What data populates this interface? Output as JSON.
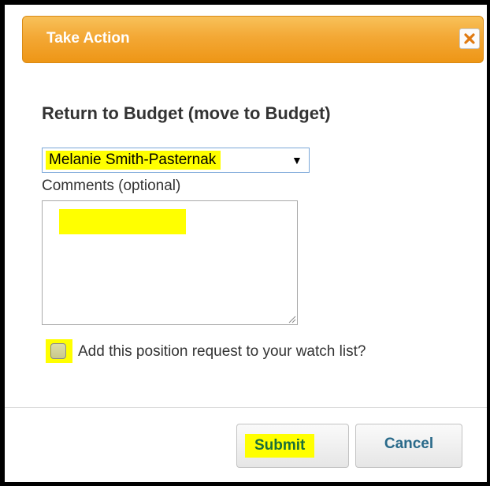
{
  "dialog": {
    "title": "Take Action",
    "close_icon": "close-x-icon",
    "heading": "Return to Budget (move to Budget)",
    "assignee_select": {
      "value": "Melanie Smith-Pasternak",
      "arrow": "▼"
    },
    "comments": {
      "label": "Comments (optional)",
      "value": ""
    },
    "watch_checkbox": {
      "label": "Add this position request to your watch list?",
      "checked": false
    },
    "buttons": {
      "submit": "Submit",
      "cancel": "Cancel"
    }
  },
  "colors": {
    "title_bar": "#f3a835",
    "highlight": "#ffff00",
    "button_text": "#2a6a8a",
    "submit_text": "#1a6e3a"
  }
}
